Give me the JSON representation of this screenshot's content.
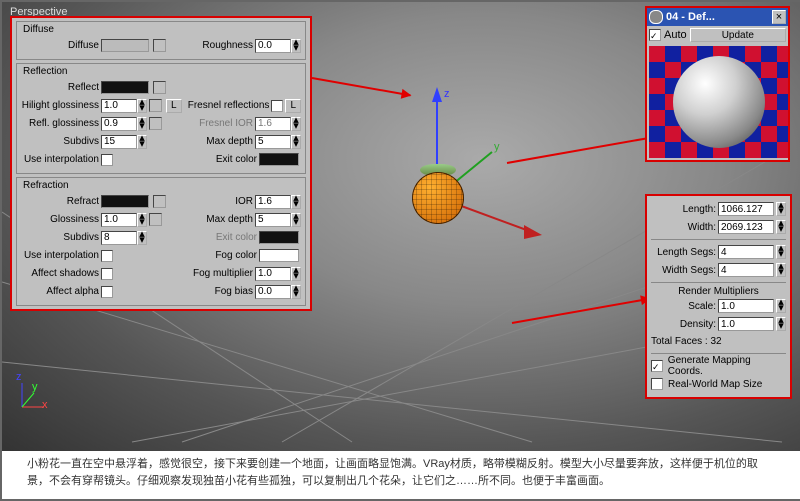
{
  "viewport": {
    "label": "Perspective"
  },
  "diffuse": {
    "title": "Diffuse",
    "label": "Diffuse",
    "rough_label": "Roughness",
    "roughness": "0.0"
  },
  "reflection": {
    "title": "Reflection",
    "reflect_label": "Reflect",
    "hilight_label": "Hilight glossiness",
    "hilight": "1.0",
    "reflgloss_label": "Refl. glossiness",
    "reflgloss": "0.9",
    "subdivs_label": "Subdivs",
    "subdivs": "15",
    "useinterp_label": "Use interpolation",
    "l_btn": "L",
    "fresnel_label": "Fresnel reflections",
    "fresnelior_label": "Fresnel IOR",
    "fresnelior": "1.6",
    "maxdepth_label": "Max depth",
    "maxdepth": "5",
    "exitcolor_label": "Exit color"
  },
  "refraction": {
    "title": "Refraction",
    "refract_label": "Refract",
    "gloss_label": "Glossiness",
    "gloss": "1.0",
    "subdivs_label": "Subdivs",
    "subdivs": "8",
    "useinterp_label": "Use interpolation",
    "affectsh_label": "Affect shadows",
    "affectal_label": "Affect alpha",
    "ior_label": "IOR",
    "ior": "1.6",
    "maxdepth_label": "Max depth",
    "maxdepth": "5",
    "exitcolor_label": "Exit color",
    "fogcolor_label": "Fog color",
    "fogmult_label": "Fog multiplier",
    "fogmult": "1.0",
    "fogbias_label": "Fog bias",
    "fogbias": "0.0"
  },
  "plane": {
    "length_label": "Length:",
    "length": "1066.127",
    "width_label": "Width:",
    "width": "2069.123",
    "lsegs_label": "Length Segs:",
    "lsegs": "4",
    "wsegs_label": "Width Segs:",
    "wsegs": "4",
    "rendmult_label": "Render Multipliers",
    "scale_label": "Scale:",
    "scale": "1.0",
    "density_label": "Density:",
    "density": "1.0",
    "faces_label": "Total Faces : 32",
    "genmap_label": "Generate Mapping Coords.",
    "realworld_label": "Real-World Map Size"
  },
  "def": {
    "title": "04 - Def...",
    "auto": "Auto",
    "update": "Update"
  },
  "caption": "小粉花一直在空中悬浮着，感觉很空，接下来要创建一个地面，让画面略显饱满。VRay材质，略带模糊反射。模型大小尽量要奔放，这样便于机位的取景，不会有穿帮镜头。仔细观察发现独苗小花有些孤独，可以复制出几个花朵，让它们之……所不同。也便于丰富画面。"
}
